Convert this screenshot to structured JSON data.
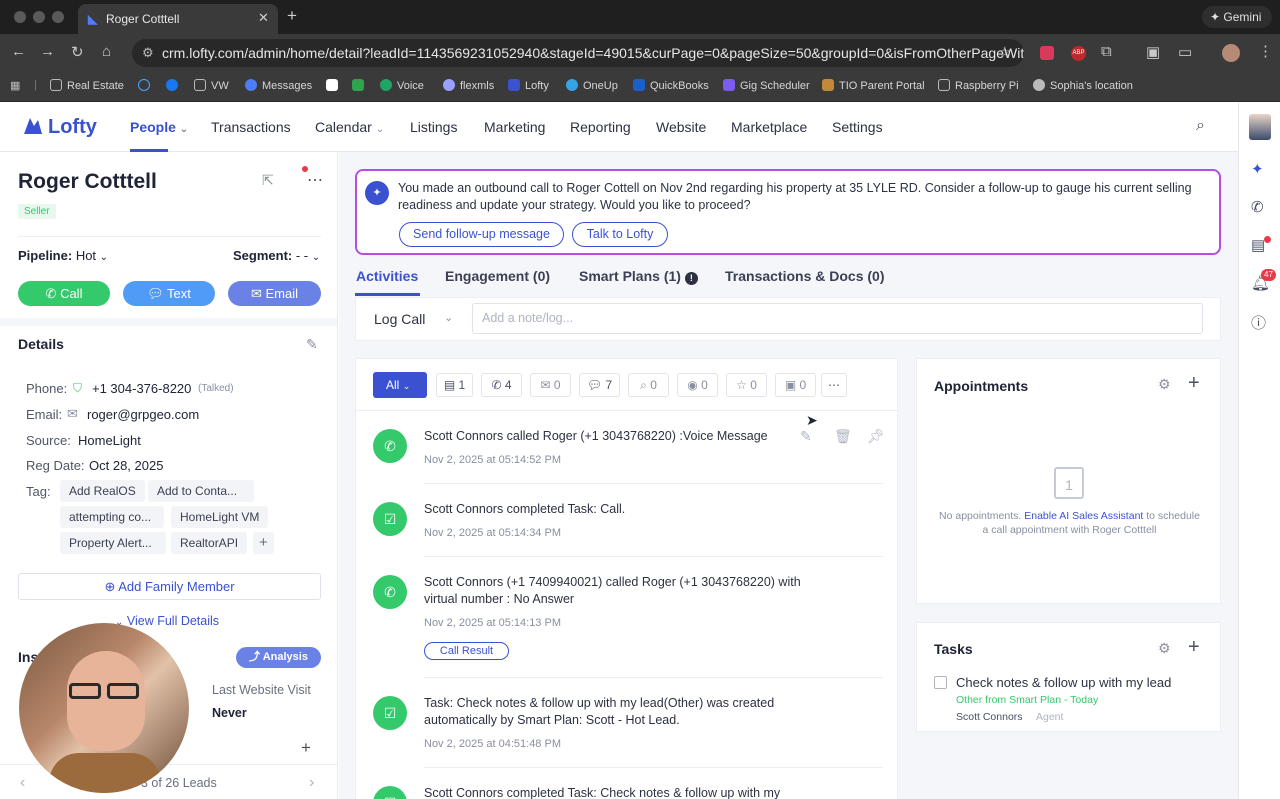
{
  "browser": {
    "tab_title": "Roger Cotttell",
    "url": "crm.lofty.com/admin/home/detail?leadId=1143569231052940&stageId=49015&curPage=0&pageSize=50&groupId=0&isFromOtherPageWithLead...",
    "gemini": "Gemini",
    "bookmarks": [
      "Real Estate",
      "VW",
      "Messages",
      "Voice",
      "flexmls",
      "Lofty",
      "OneUp",
      "QuickBooks",
      "Gig Scheduler",
      "TIO Parent Portal",
      "Raspberry Pi",
      "Sophia's location"
    ]
  },
  "app": {
    "logo": "Lofty",
    "nav": [
      "People",
      "Transactions",
      "Calendar",
      "Listings",
      "Marketing",
      "Reporting",
      "Website",
      "Marketplace",
      "Settings"
    ],
    "notification_count": "47"
  },
  "lead": {
    "name": "Roger Cotttell",
    "badge": "Seller",
    "pipeline_label": "Pipeline:",
    "pipeline_value": "Hot",
    "segment_label": "Segment:",
    "segment_value": "- -",
    "call": "Call",
    "text": "Text",
    "email": "Email",
    "details_title": "Details",
    "phone_label": "Phone:",
    "phone": "+1 304-376-8220",
    "phone_note": "(Talked)",
    "email_label": "Email:",
    "email_value": "roger@grpgeo.com",
    "source_label": "Source:",
    "source": "HomeLight",
    "reg_label": "Reg Date:",
    "reg_date": "Oct 28, 2025",
    "tag_label": "Tag:",
    "tags": [
      "Add RealOS",
      "Add to Conta...",
      "attempting co...",
      "HomeLight VM",
      "Property Alert...",
      "RealtorAPI"
    ],
    "add_family": "Add Family Member",
    "view_full": "View Full Details",
    "insights_prefix": "Ins",
    "analysis": "Analysis",
    "last_visit_label": "Last Website Visit",
    "last_visit": "Never",
    "pager": "3 of 26 Leads"
  },
  "banner": {
    "text": "You made an outbound call to Roger Cottell on Nov 2nd regarding his property at 35 LYLE RD. Consider a follow-up to gauge his current selling readiness and update your strategy. Would you like to proceed?",
    "btn1": "Send follow-up message",
    "btn2": "Talk to Lofty"
  },
  "tabs": [
    "Activities",
    "Engagement (0)",
    "Smart Plans (1)",
    "Transactions & Docs (0)"
  ],
  "log": {
    "type": "Log Call",
    "placeholder": "Add a note/log..."
  },
  "filters": {
    "all": "All",
    "counts": [
      "1",
      "4",
      "0",
      "7",
      "0",
      "0",
      "0",
      "0"
    ]
  },
  "activities": [
    {
      "text": "Scott Connors called Roger (+1 3043768220) :Voice Message",
      "date": "Nov 2, 2025 at 05:14:52 PM"
    },
    {
      "text": "Scott Connors completed Task: Call.",
      "date": "Nov 2, 2025 at 05:14:34 PM"
    },
    {
      "text": "Scott Connors (+1 7409940021) called Roger (+1 3043768220) with",
      "text2": "virtual number : No Answer",
      "date": "Nov 2, 2025 at 05:14:13 PM",
      "button": "Call Result"
    },
    {
      "text": "Task: Check notes & follow up with my lead(Other) was created",
      "text2": "automatically by Smart Plan: Scott - Hot Lead.",
      "date": "Nov 2, 2025 at 04:51:48 PM"
    },
    {
      "text": "Scott Connors completed Task: Check notes & follow up with my"
    }
  ],
  "appointments": {
    "title": "Appointments",
    "empty_text": "No appointments.",
    "link": "Enable AI Sales Assistant",
    "after_link": "to schedule",
    "line2": "a call appointment with Roger Cotttell",
    "calendar_day": "1"
  },
  "tasks": {
    "title": "Tasks",
    "item": "Check notes & follow up with my lead",
    "sub": "Other from Smart Plan - Today",
    "owner": "Scott Connors",
    "role": "Agent"
  },
  "colors": {
    "accent": "#3a52d1",
    "green": "#34c96a",
    "purple": "#b64ee6"
  }
}
